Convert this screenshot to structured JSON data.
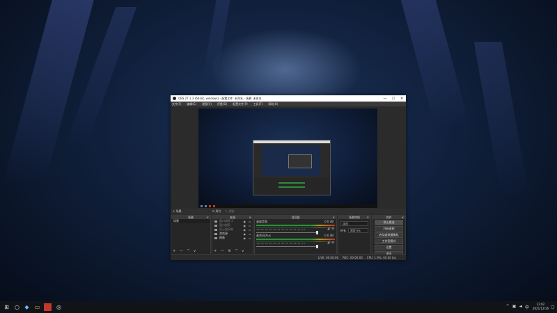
{
  "window": {
    "title": "OBS 27.1.3 (64-bit, windows) - 配置文件: 未命名 - 场景: 未命名",
    "minimize": "—",
    "maximize": "☐",
    "close": "✕",
    "menu": [
      "文件(F)",
      "编辑(E)",
      "视图(V)",
      "停靠(D)",
      "配置文件(P)",
      "工具(T)",
      "帮助(H)"
    ]
  },
  "scene_bar": {
    "current": "+ 场景",
    "center_left": "⚙ 属性",
    "center_right": "✎ 滤镜"
  },
  "docks": {
    "scenes": {
      "header": "场景",
      "items": [
        "场景"
      ],
      "toolbar": "+ — ^ v"
    },
    "sources": {
      "header": "来源",
      "items": [
        "窗口捕获 2",
        "窗口捕获",
        "显示器采集",
        "游戏源",
        "图像"
      ],
      "toolbar": "+ — ⚙ ^ v"
    },
    "mixer": {
      "header": "混音器",
      "channels": [
        {
          "name": "桌面音频",
          "db": "0.0 dB",
          "ticks": "-60 -55 -50 -45 -40 -35 -30 -25 -20 -15 -10 -5 0"
        },
        {
          "name": "麦克风/Aux",
          "db": "0.0 dB",
          "ticks": "-60 -55 -50 -45 -40 -35 -30 -25 -20 -15 -10 -5 0"
        }
      ]
    },
    "transitions": {
      "header": "场景转换",
      "selected": "淡出",
      "duration_label": "时长",
      "duration_value": "300 ms"
    },
    "controls": {
      "header": "控件",
      "buttons": [
        "停止推流",
        "开始录制",
        "启动虚拟摄像机",
        "工作室模式",
        "设置",
        "退出"
      ]
    }
  },
  "status": {
    "live": "LIVE: 00:00:00",
    "rec": "REC: 00:00:00",
    "cpu": "CPU: 1.9%, 60.00 fps"
  },
  "taskbar": {
    "start_icon": "windows-logo-icon",
    "clock_time": "12:02",
    "clock_date": "2021/12/16",
    "tray_lang": "中"
  }
}
